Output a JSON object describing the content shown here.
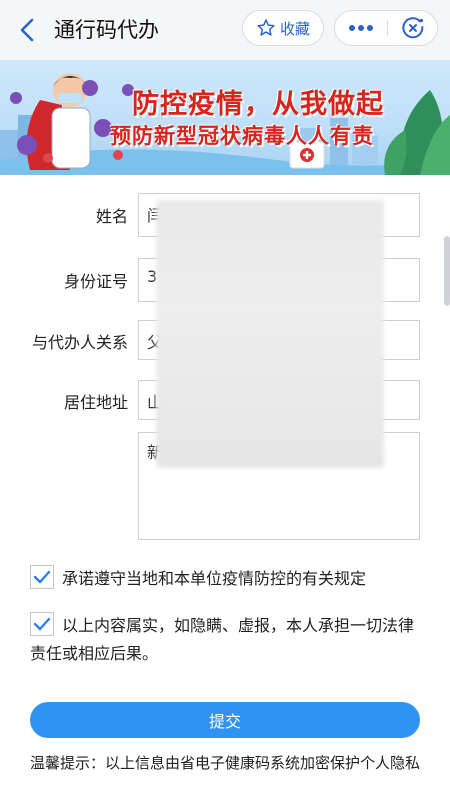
{
  "header": {
    "title": "通行码代办",
    "favorite_label": "收藏"
  },
  "banner": {
    "line1": "防控疫情，从我做起",
    "line2": "预防新型冠状病毒人人有责"
  },
  "form": {
    "fields": [
      {
        "label": "姓名",
        "value": "闫"
      },
      {
        "label": "身份证号",
        "value": "3"
      },
      {
        "label": "与代办人关系",
        "value": "父"
      },
      {
        "label": "居住地址",
        "value": "山"
      }
    ],
    "address_detail": "新"
  },
  "agreements": [
    {
      "text": "承诺遵守当地和本单位疫情防控的有关规定",
      "checked": true
    },
    {
      "text": "以上内容属实，如隐瞒、虚报，本人承担一切法律责任或相应后果。",
      "checked": true
    }
  ],
  "submit_label": "提交",
  "tip": "温馨提示：以上信息由省电子健康码系统加密保护个人隐私",
  "colors": {
    "accent": "#2f93f1",
    "check": "#2a82e4",
    "banner_text": "#d8241b"
  }
}
